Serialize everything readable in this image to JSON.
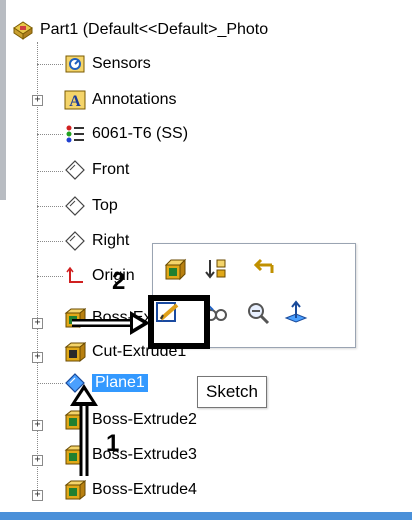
{
  "tree": {
    "root": {
      "label": "Part1  (Default<<Default>_Photo",
      "icon": "part-icon"
    },
    "items": [
      {
        "label": "Sensors",
        "icon": "sensors-icon",
        "expandable": false
      },
      {
        "label": "Annotations",
        "icon": "annotations-icon",
        "expandable": true
      },
      {
        "label": "6061-T6 (SS)",
        "icon": "material-icon",
        "expandable": false
      },
      {
        "label": "Front",
        "icon": "plane-icon",
        "expandable": false
      },
      {
        "label": "Top",
        "icon": "plane-icon",
        "expandable": false
      },
      {
        "label": "Right",
        "icon": "plane-icon",
        "expandable": false
      },
      {
        "label": "Origin",
        "icon": "origin-icon",
        "expandable": false
      },
      {
        "label": "Boss-Extrude1",
        "icon": "extrude-icon",
        "expandable": true
      },
      {
        "label": "Cut-Extrude1",
        "icon": "cut-extrude-icon",
        "expandable": true
      },
      {
        "label": "Plane1",
        "icon": "plane-selected-icon",
        "expandable": false,
        "selected": true
      },
      {
        "label": "Boss-Extrude2",
        "icon": "extrude-icon",
        "expandable": true
      },
      {
        "label": "Boss-Extrude3",
        "icon": "extrude-icon",
        "expandable": true
      },
      {
        "label": "Boss-Extrude4",
        "icon": "extrude-icon",
        "expandable": true
      }
    ]
  },
  "context_toolbar": {
    "row1": [
      "feature-properties-icon",
      "sort-icon",
      "rollback-icon"
    ],
    "row2": [
      "sketch-icon",
      "hide-show-icon",
      "zoom-to-selection-icon",
      "normal-to-icon"
    ]
  },
  "tooltip": {
    "text": "Sketch"
  },
  "annotations": {
    "step1": "1",
    "step2": "2"
  },
  "colors": {
    "selection": "#3399ff",
    "accent_blue": "#4a90d9",
    "highlight_box": "#000000"
  }
}
